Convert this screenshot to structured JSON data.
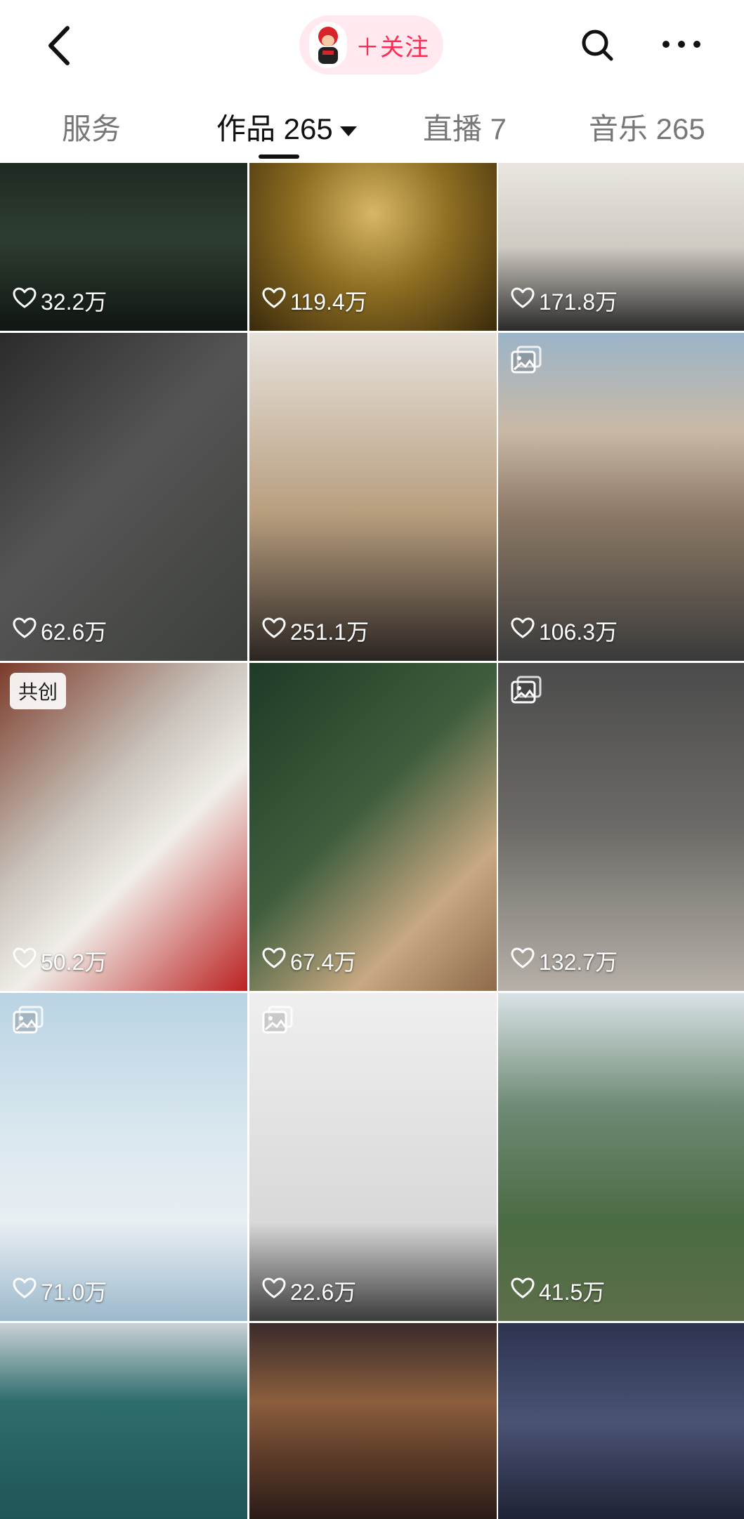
{
  "header": {
    "follow_label": "＋关注",
    "icons": [
      "back-arrow-icon",
      "avatar",
      "search-icon",
      "more-icon"
    ]
  },
  "tabs": [
    {
      "label": "服务",
      "active": false
    },
    {
      "label": "作品 265",
      "active": true
    },
    {
      "label": "直播 7",
      "active": false
    },
    {
      "label": "音乐 265",
      "active": false
    }
  ],
  "posts": [
    {
      "likes": "32.2万",
      "theme": "rainy-night",
      "badge": null,
      "image_icon": false
    },
    {
      "likes": "119.4万",
      "theme": "golden-sparkle",
      "badge": null,
      "image_icon": false
    },
    {
      "likes": "171.8万",
      "theme": "white-tee-mic",
      "badge": null,
      "image_icon": false
    },
    {
      "likes": "62.6万",
      "theme": "gray-jacket-portrait",
      "badge": null,
      "image_icon": false
    },
    {
      "likes": "251.1万",
      "theme": "private-jet",
      "badge": null,
      "image_icon": false
    },
    {
      "likes": "106.3万",
      "theme": "green-hoodie-desert",
      "badge": null,
      "image_icon": true
    },
    {
      "likes": "50.2万",
      "theme": "book-white-hoodie",
      "badge": "共创",
      "image_icon": false
    },
    {
      "likes": "67.4万",
      "theme": "christmas-tree",
      "badge": null,
      "image_icon": false
    },
    {
      "likes": "132.7万",
      "theme": "gray-coat-suitcase",
      "badge": null,
      "image_icon": true
    },
    {
      "likes": "71.0万",
      "theme": "blue-shirt-sea",
      "badge": null,
      "image_icon": true
    },
    {
      "likes": "22.6万",
      "theme": "white-suitcase",
      "badge": null,
      "image_icon": true
    },
    {
      "likes": "41.5万",
      "theme": "coastal-town",
      "badge": null,
      "image_icon": false
    },
    {
      "likes": "",
      "theme": "tennis-court",
      "badge": null,
      "image_icon": false
    },
    {
      "likes": "",
      "theme": "concert-crowd",
      "badge": null,
      "image_icon": false
    },
    {
      "likes": "",
      "theme": "stadium-night",
      "badge": null,
      "image_icon": false
    }
  ],
  "colors": {
    "accent": "#fe2c55",
    "follow_bg": "#ffe9ee",
    "active_tab": "#111111",
    "inactive_tab": "#777777"
  }
}
